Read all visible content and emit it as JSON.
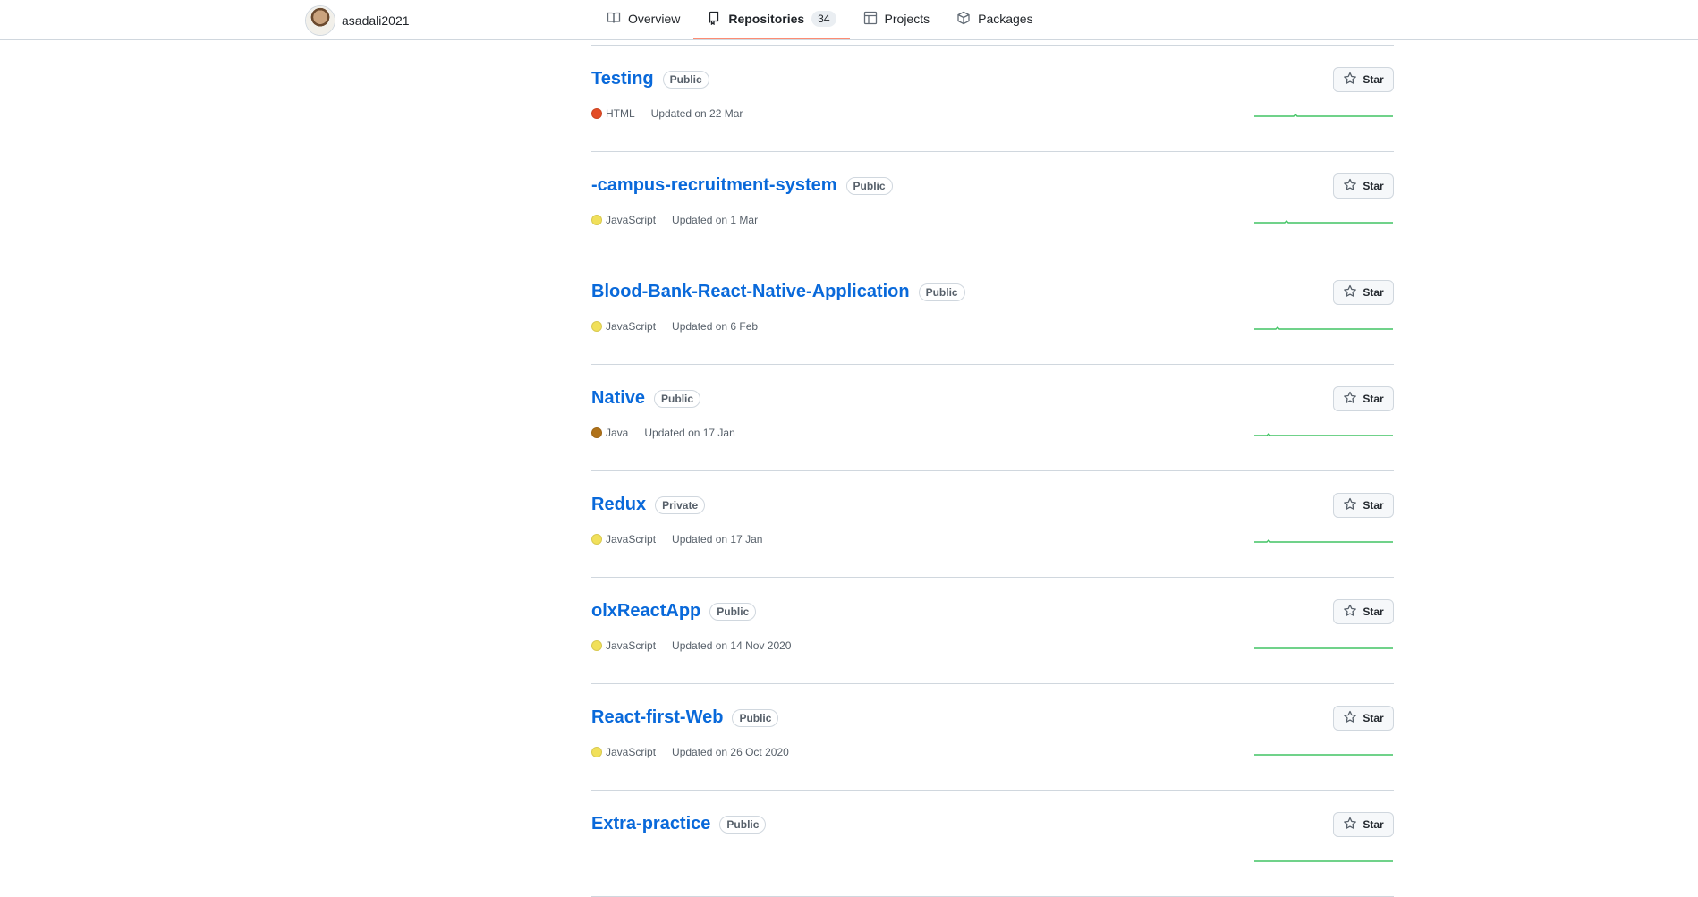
{
  "profile": {
    "username": "asadali2021"
  },
  "tabs": [
    {
      "label": "Overview",
      "icon": "book-icon",
      "selected": false
    },
    {
      "label": "Repositories",
      "icon": "repo-icon",
      "selected": true,
      "count": "34"
    },
    {
      "label": "Projects",
      "icon": "table-icon",
      "selected": false
    },
    {
      "label": "Packages",
      "icon": "package-icon",
      "selected": false
    }
  ],
  "colors": {
    "link": "#0969da",
    "tab_underline": "#fd8c73",
    "sparkline": "#40c463"
  },
  "repositories": [
    {
      "name": "Testing",
      "visibility": "Public",
      "language": "HTML",
      "language_color": "#e34c26",
      "updated": "Updated on 22 Mar",
      "star_label": "Star"
    },
    {
      "name": "-campus-recruitment-system",
      "visibility": "Public",
      "language": "JavaScript",
      "language_color": "#f1e05a",
      "updated": "Updated on 1 Mar",
      "star_label": "Star"
    },
    {
      "name": "Blood-Bank-React-Native-Application",
      "visibility": "Public",
      "language": "JavaScript",
      "language_color": "#f1e05a",
      "updated": "Updated on 6 Feb",
      "star_label": "Star"
    },
    {
      "name": "Native",
      "visibility": "Public",
      "language": "Java",
      "language_color": "#b07219",
      "updated": "Updated on 17 Jan",
      "star_label": "Star"
    },
    {
      "name": "Redux",
      "visibility": "Private",
      "language": "JavaScript",
      "language_color": "#f1e05a",
      "updated": "Updated on 17 Jan",
      "star_label": "Star"
    },
    {
      "name": "olxReactApp",
      "visibility": "Public",
      "language": "JavaScript",
      "language_color": "#f1e05a",
      "updated": "Updated on 14 Nov 2020",
      "star_label": "Star"
    },
    {
      "name": "React-first-Web",
      "visibility": "Public",
      "language": "JavaScript",
      "language_color": "#f1e05a",
      "updated": "Updated on 26 Oct 2020",
      "star_label": "Star"
    },
    {
      "name": "Extra-practice",
      "visibility": "Public",
      "language": "",
      "language_color": "",
      "updated": "",
      "star_label": "Star"
    }
  ]
}
